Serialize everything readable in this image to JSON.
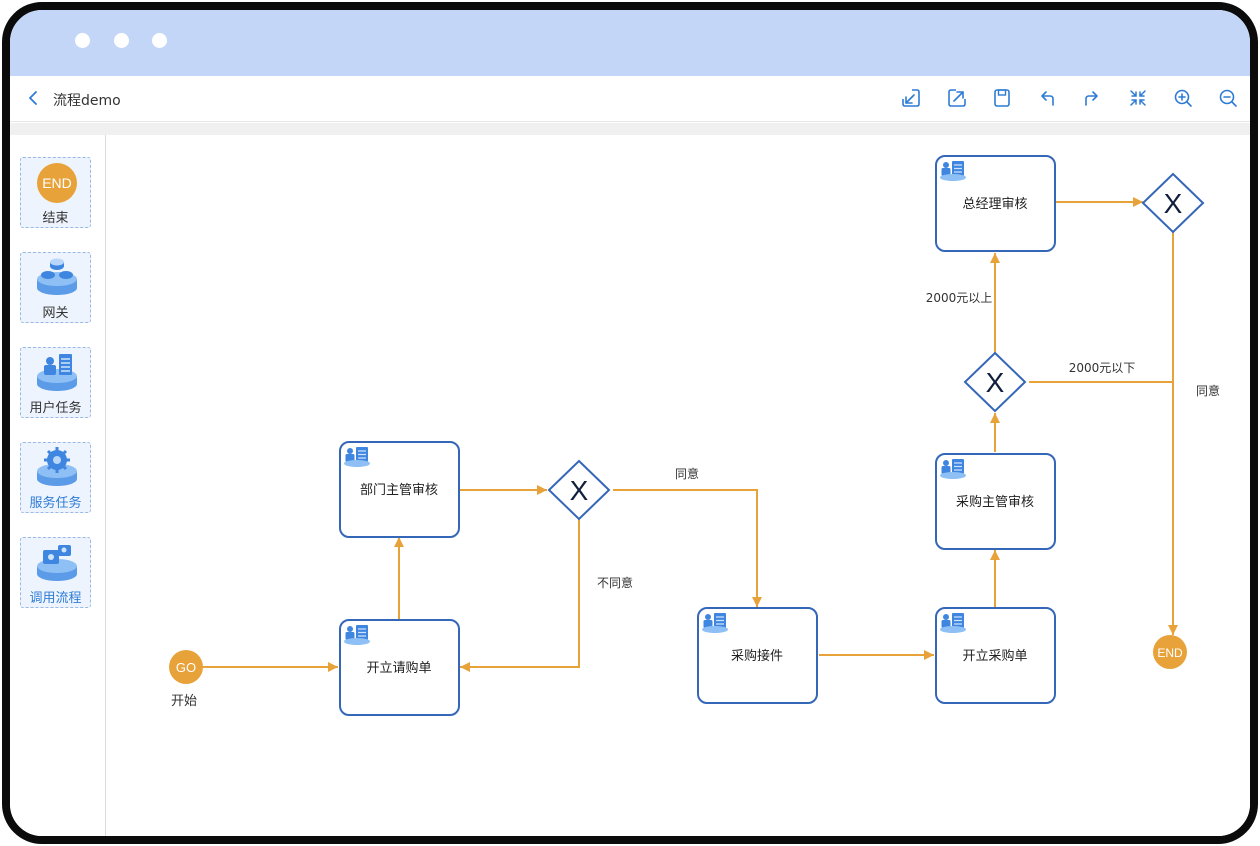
{
  "window": {
    "title": "流程demo"
  },
  "toolbar": {
    "buttons": [
      {
        "icon": "import-icon"
      },
      {
        "icon": "export-icon"
      },
      {
        "icon": "save-icon"
      },
      {
        "icon": "undo-icon"
      },
      {
        "icon": "redo-icon"
      },
      {
        "icon": "fit-view-icon"
      },
      {
        "icon": "zoom-in-icon"
      },
      {
        "icon": "zoom-out-icon"
      }
    ]
  },
  "palette": {
    "items": [
      {
        "label": "结束",
        "badge": "END",
        "icon": "end-event-icon"
      },
      {
        "label": "网关",
        "icon": "gateway-icon"
      },
      {
        "label": "用户任务",
        "icon": "user-task-icon"
      },
      {
        "label": "服务任务",
        "icon": "service-task-icon"
      },
      {
        "label": "调用流程",
        "icon": "call-process-icon"
      }
    ]
  },
  "diagram": {
    "start": {
      "badge": "GO",
      "label": "开始"
    },
    "end": {
      "badge": "END"
    },
    "tasks": {
      "create_request": "开立请购单",
      "dept_review": "部门主管审核",
      "purchase_accept": "采购接件",
      "create_po": "开立采购单",
      "purchase_review": "采购主管审核",
      "gm_review": "总经理审核"
    },
    "gateway_mark": "X",
    "edge_labels": {
      "agree_1": "同意",
      "disagree": "不同意",
      "above_2000": "2000元以上",
      "below_2000": "2000元以下",
      "agree_2": "同意"
    }
  },
  "colors": {
    "titlebar": "#c3d6f7",
    "accent": "#2e7bd6",
    "node_border": "#3567b8",
    "flow": "#e8a23a",
    "event": "#e8a23a"
  }
}
